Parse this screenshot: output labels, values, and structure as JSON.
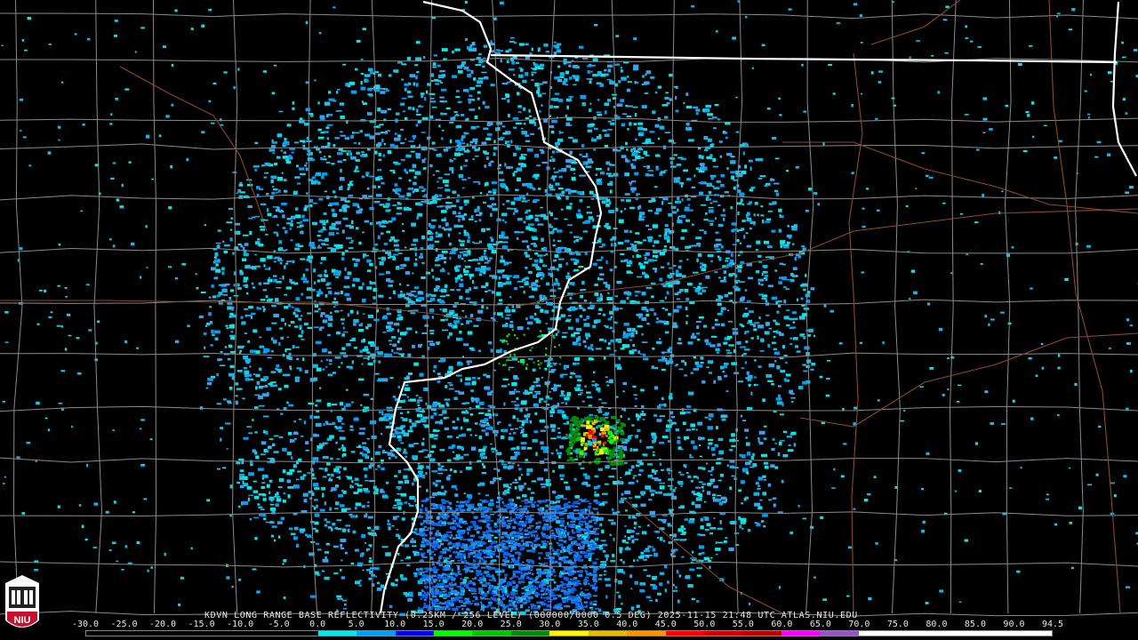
{
  "product": {
    "title": "KDVN LONG RANGE BASE REFLECTIVITY (0.25KM / 256 LEVEL) (000000/0000 0.5 DEG) 2025-11-15 21:48 UTC  ATLAS.NIU.EDU",
    "station": "KDVN",
    "timestamp": "2025-11-15 21:48 UTC",
    "source": "ATLAS.NIU.EDU"
  },
  "logo": {
    "text": "NIU",
    "color": "#c8102e",
    "icon": "university-tower-icon"
  },
  "legend": {
    "ticks": [
      "-30.0",
      "-25.0",
      "-20.0",
      "-15.0",
      "-10.0",
      "-5.0",
      "0.0",
      "5.0",
      "10.0",
      "15.0",
      "20.0",
      "25.0",
      "30.0",
      "35.0",
      "40.0",
      "45.0",
      "50.0",
      "55.0",
      "60.0",
      "65.0",
      "70.0",
      "75.0",
      "80.0",
      "85.0",
      "90.0",
      "94.5"
    ],
    "colors": [
      "#000000",
      "#000000",
      "#000000",
      "#000000",
      "#000000",
      "#000000",
      "#04e9e7",
      "#019ff4",
      "#0300f4",
      "#02fd02",
      "#01c501",
      "#008e00",
      "#fdf802",
      "#e5bc00",
      "#fd9500",
      "#fd0000",
      "#d40000",
      "#bc0000",
      "#f800fd",
      "#9854c6",
      "#fdfdfd",
      "#fdfdfd",
      "#fdfdfd",
      "#fdfdfd",
      "#fdfdfd"
    ]
  },
  "map": {
    "radar_center": "KDVN",
    "overlays": [
      "county-borders",
      "state-borders",
      "interstate-highways"
    ],
    "county_color": "#8a8a8a",
    "state_color": "#ffffff",
    "highway_color": "#8b4a2a"
  }
}
